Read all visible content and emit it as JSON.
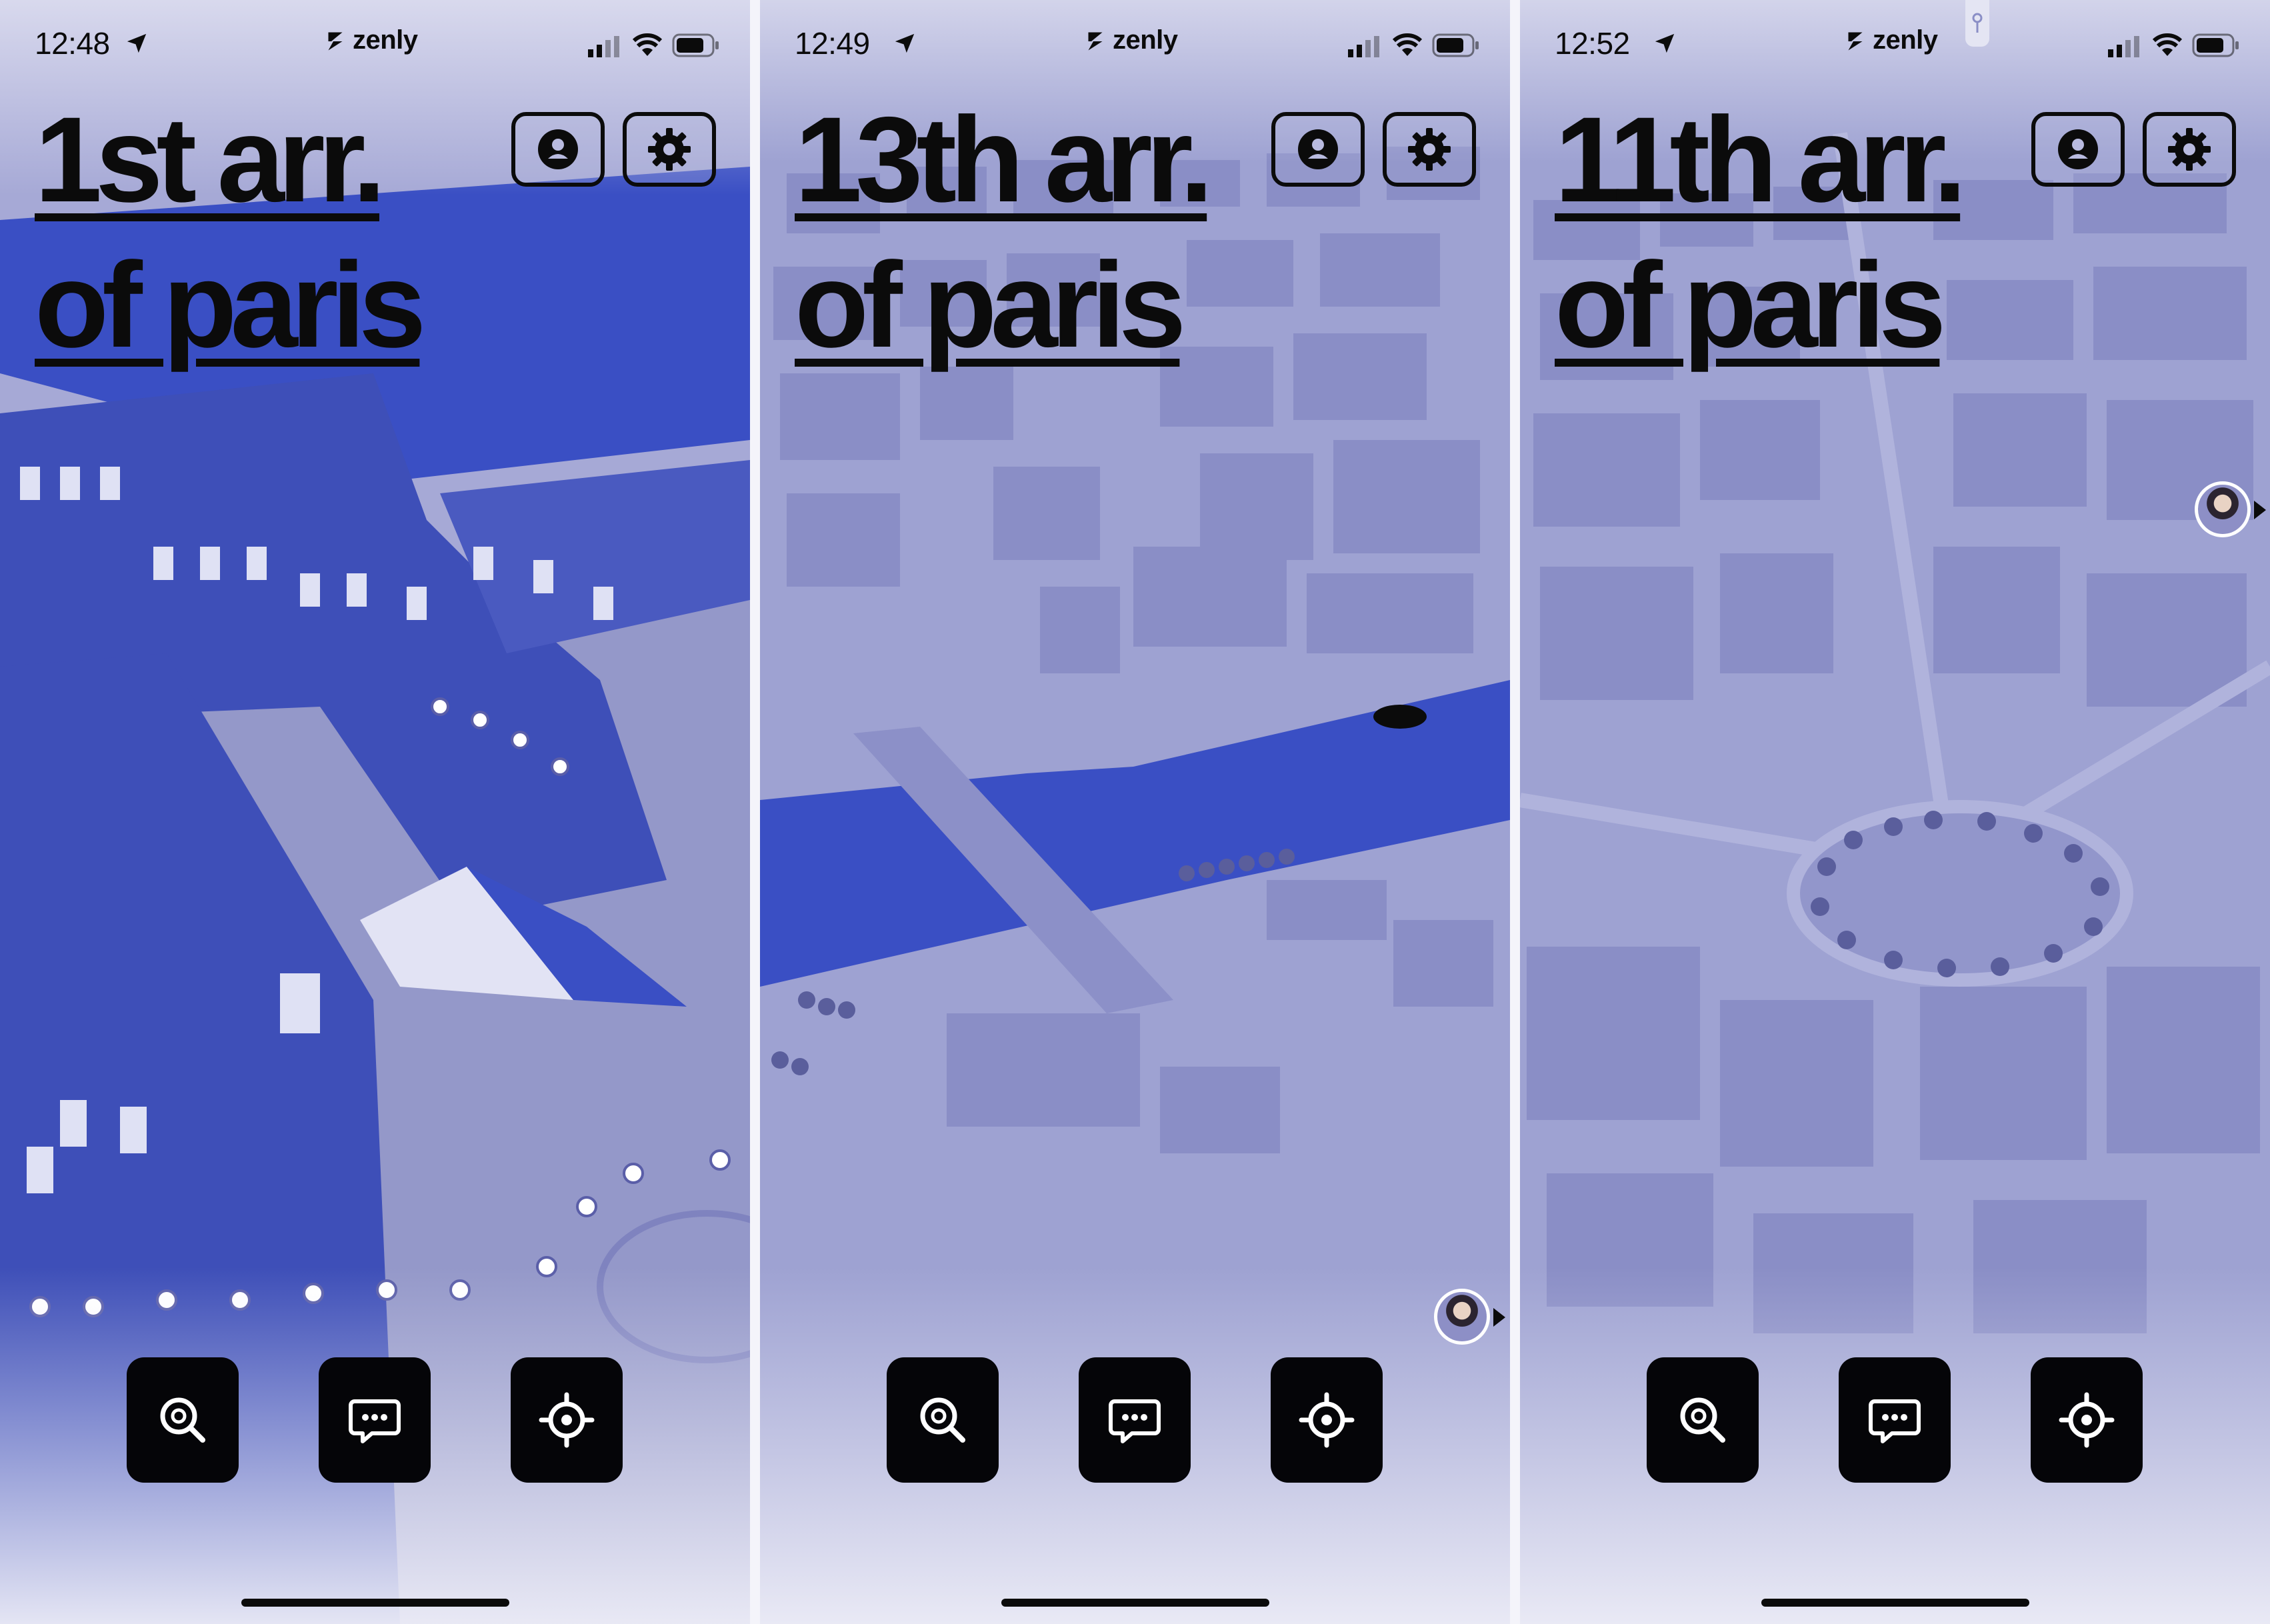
{
  "colors": {
    "text": "#0b0b0b",
    "map_tint": "#9ea2d2",
    "water": "#3a4fc4",
    "button_dark": "#050508"
  },
  "status": {
    "carrier": "zenly"
  },
  "icons": {
    "location_arrow": "location-arrow-icon",
    "carrier_logo": "zenly-logo-icon",
    "signal": "signal-icon",
    "wifi": "wifi-icon",
    "battery": "battery-icon",
    "profile": "profile-icon",
    "settings": "gear-icon",
    "search": "search-icon",
    "chat": "chat-icon",
    "locate": "locate-icon"
  },
  "screens": [
    {
      "time": "12:48",
      "title_line1": "1st arr.",
      "title_line2": "of paris",
      "map_scene": "louvre"
    },
    {
      "time": "12:49",
      "title_line1": "13th arr.",
      "title_line2": "of paris",
      "map_scene": "river"
    },
    {
      "time": "12:52",
      "title_line1": "11th arr.",
      "title_line2": "of paris",
      "map_scene": "city"
    }
  ]
}
